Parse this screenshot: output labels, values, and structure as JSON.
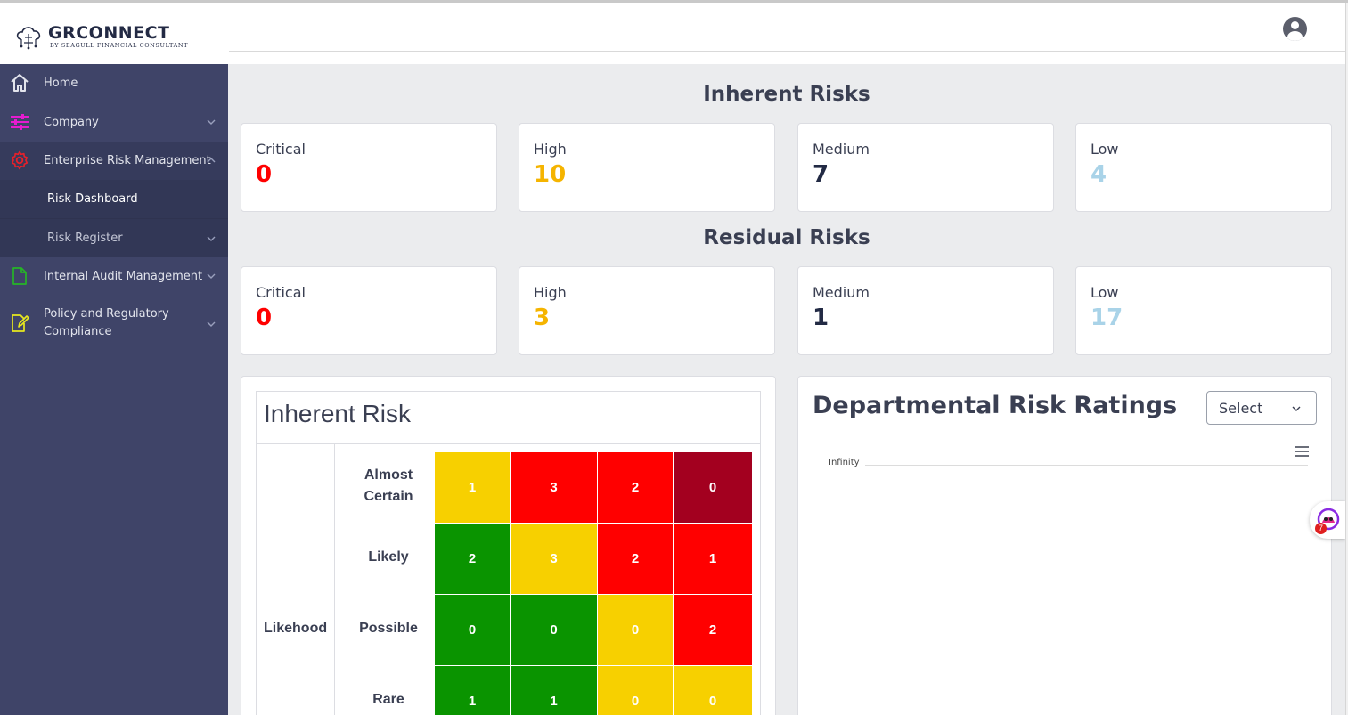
{
  "app": {
    "logo_title": "GRCONNECT",
    "logo_subtitle": "BY SEAGULL FINANCIAL CONSULTANT"
  },
  "sidebar": {
    "items": [
      {
        "label": "Home",
        "icon": "home-icon",
        "color": "#e2e4ec"
      },
      {
        "label": "Company",
        "icon": "sliders-icon",
        "color": "#e61bd0"
      },
      {
        "label": "Enterprise Risk Management",
        "icon": "gear-icon",
        "color": "#e8202a"
      },
      {
        "label": "Risk Dashboard"
      },
      {
        "label": "Risk Register"
      },
      {
        "label": "Internal Audit Management",
        "icon": "document-icon",
        "color": "#26b526"
      },
      {
        "label": "Policy and Regulatory",
        "label2": "Compliance",
        "icon": "edit-document-icon",
        "color": "#e8e81e"
      }
    ]
  },
  "inherent": {
    "title": "Inherent Risks",
    "cards": [
      {
        "label": "Critical",
        "value": "0",
        "color": "#ff0000"
      },
      {
        "label": "High",
        "value": "10",
        "color": "#f5b400"
      },
      {
        "label": "Medium",
        "value": "7",
        "color": "#222a44"
      },
      {
        "label": "Low",
        "value": "4",
        "color": "#a9d3e8"
      }
    ]
  },
  "residual": {
    "title": "Residual Risks",
    "cards": [
      {
        "label": "Critical",
        "value": "0",
        "color": "#ff0000"
      },
      {
        "label": "High",
        "value": "3",
        "color": "#f5b400"
      },
      {
        "label": "Medium",
        "value": "1",
        "color": "#222a44"
      },
      {
        "label": "Low",
        "value": "17",
        "color": "#a9d3e8"
      }
    ]
  },
  "matrix": {
    "title": "Inherent Risk",
    "axis_label": "Likehood",
    "rows": [
      {
        "label": "Almost",
        "label2": "Certain",
        "cells": [
          {
            "value": "1",
            "color": "#f7d000"
          },
          {
            "value": "3",
            "color": "#ff0000"
          },
          {
            "value": "2",
            "color": "#ff0000"
          },
          {
            "value": "0",
            "color": "#a3001f"
          }
        ]
      },
      {
        "label": "Likely",
        "cells": [
          {
            "value": "2",
            "color": "#0a9400"
          },
          {
            "value": "3",
            "color": "#f7d000"
          },
          {
            "value": "2",
            "color": "#ff0000"
          },
          {
            "value": "1",
            "color": "#ff0000"
          }
        ]
      },
      {
        "label": "Possible",
        "cells": [
          {
            "value": "0",
            "color": "#0a9400"
          },
          {
            "value": "0",
            "color": "#0a9400"
          },
          {
            "value": "0",
            "color": "#f7d000"
          },
          {
            "value": "2",
            "color": "#ff0000"
          }
        ]
      },
      {
        "label": "Rare",
        "cells": [
          {
            "value": "1",
            "color": "#0a9400"
          },
          {
            "value": "1",
            "color": "#0a9400"
          },
          {
            "value": "0",
            "color": "#f7d000"
          },
          {
            "value": "0",
            "color": "#f7d000"
          }
        ]
      }
    ]
  },
  "departmental": {
    "title": "Departmental Risk Ratings",
    "select_value": "Select",
    "axis_tick": "Infinity"
  },
  "chat": {
    "badge": "7"
  }
}
